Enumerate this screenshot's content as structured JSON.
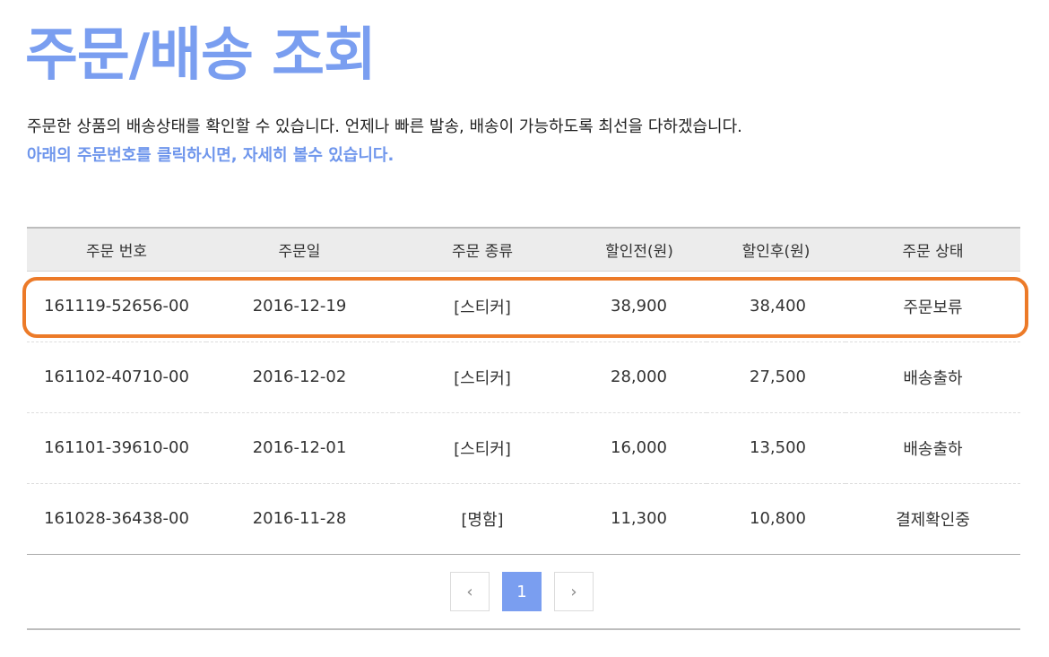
{
  "page": {
    "title": "주문/배송 조회",
    "description": "주문한 상품의 배송상태를 확인할 수 있습니다. 언제나 빠른 발송, 배송이 가능하도록 최선을 다하겠습니다.",
    "notice": "아래의 주문번호를 클릭하시면, 자세히 볼수 있습니다."
  },
  "table": {
    "headers": {
      "order_no": "주문 번호",
      "order_date": "주문일",
      "order_type": "주문 종류",
      "price_before": "할인전(원)",
      "price_after": "할인후(원)",
      "status": "주문 상태"
    },
    "rows": [
      {
        "order_no": "161119-52656-00",
        "order_date": "2016-12-19",
        "order_type": "[스티커]",
        "price_before": "38,900",
        "price_after": "38,400",
        "status": "주문보류"
      },
      {
        "order_no": "161102-40710-00",
        "order_date": "2016-12-02",
        "order_type": "[스티커]",
        "price_before": "28,000",
        "price_after": "27,500",
        "status": "배송출하"
      },
      {
        "order_no": "161101-39610-00",
        "order_date": "2016-12-01",
        "order_type": "[스티커]",
        "price_before": "16,000",
        "price_after": "13,500",
        "status": "배송출하"
      },
      {
        "order_no": "161028-36438-00",
        "order_date": "2016-11-28",
        "order_type": "[명함]",
        "price_before": "11,300",
        "price_after": "10,800",
        "status": "결제확인중"
      }
    ]
  },
  "pagination": {
    "prev_icon": "‹",
    "current_page": "1",
    "next_icon": "›"
  },
  "colors": {
    "title": "#7a9ef0",
    "accent_red": "#f2876e",
    "highlight_border": "#ec7a28"
  }
}
